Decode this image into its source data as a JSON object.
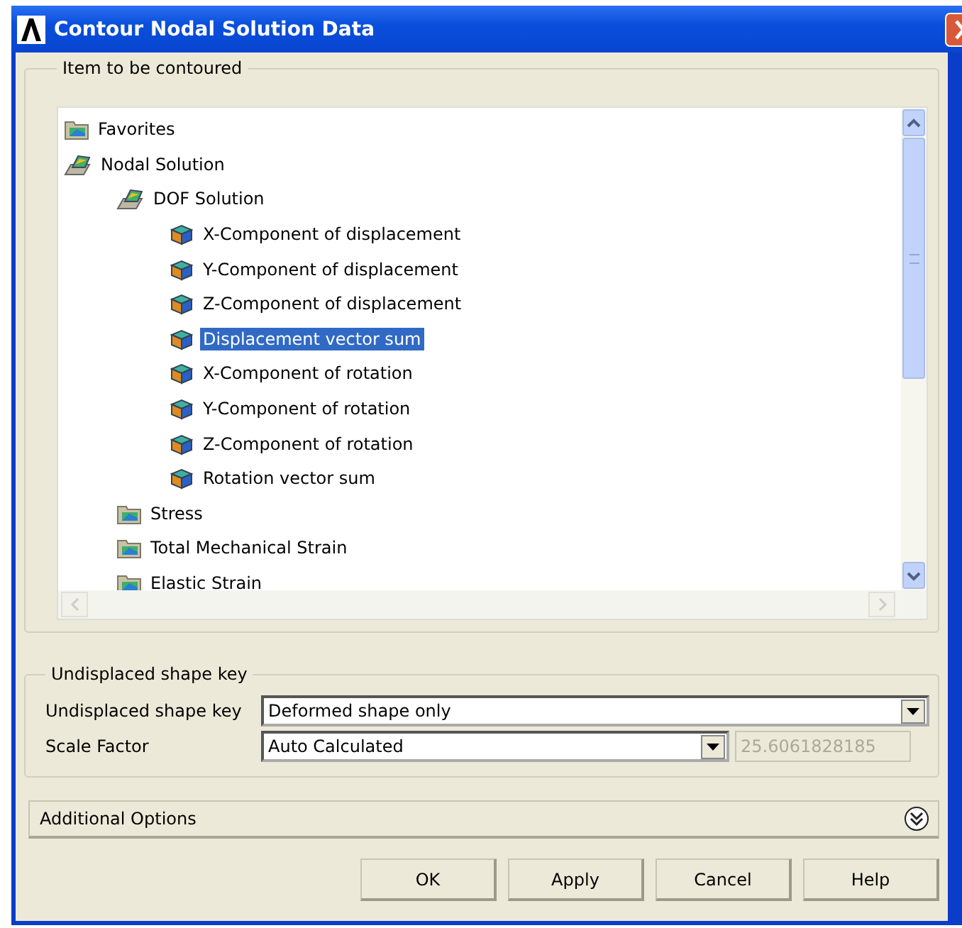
{
  "window": {
    "title": "Contour Nodal Solution Data"
  },
  "item_group": {
    "title": "Item to be contoured",
    "tree": [
      {
        "label": "Favorites",
        "kind": "folder",
        "selected": false
      },
      {
        "label": "Nodal Solution",
        "kind": "group",
        "selected": false,
        "children": [
          {
            "label": "DOF Solution",
            "kind": "group",
            "selected": false,
            "children": [
              {
                "label": "X-Component of displacement",
                "kind": "item",
                "selected": false
              },
              {
                "label": "Y-Component of displacement",
                "kind": "item",
                "selected": false
              },
              {
                "label": "Z-Component of displacement",
                "kind": "item",
                "selected": false
              },
              {
                "label": "Displacement vector sum",
                "kind": "item",
                "selected": true
              },
              {
                "label": "X-Component of rotation",
                "kind": "item",
                "selected": false
              },
              {
                "label": "Y-Component of rotation",
                "kind": "item",
                "selected": false
              },
              {
                "label": "Z-Component of rotation",
                "kind": "item",
                "selected": false
              },
              {
                "label": "Rotation vector sum",
                "kind": "item",
                "selected": false
              }
            ]
          },
          {
            "label": "Stress",
            "kind": "folder",
            "selected": false
          },
          {
            "label": "Total Mechanical Strain",
            "kind": "folder",
            "selected": false
          },
          {
            "label": "Elastic Strain",
            "kind": "folder",
            "selected": false
          }
        ]
      }
    ]
  },
  "shape_group": {
    "title": "Undisplaced shape key",
    "fields": [
      {
        "label": "Undisplaced shape key",
        "value": "Deformed shape only"
      },
      {
        "label": "Scale Factor",
        "value": "Auto Calculated",
        "extra_value": "25.6061828185",
        "extra_disabled": true
      }
    ]
  },
  "additional_options": {
    "label": "Additional Options",
    "expanded": false
  },
  "buttons": [
    "OK",
    "Apply",
    "Cancel",
    "Help"
  ]
}
